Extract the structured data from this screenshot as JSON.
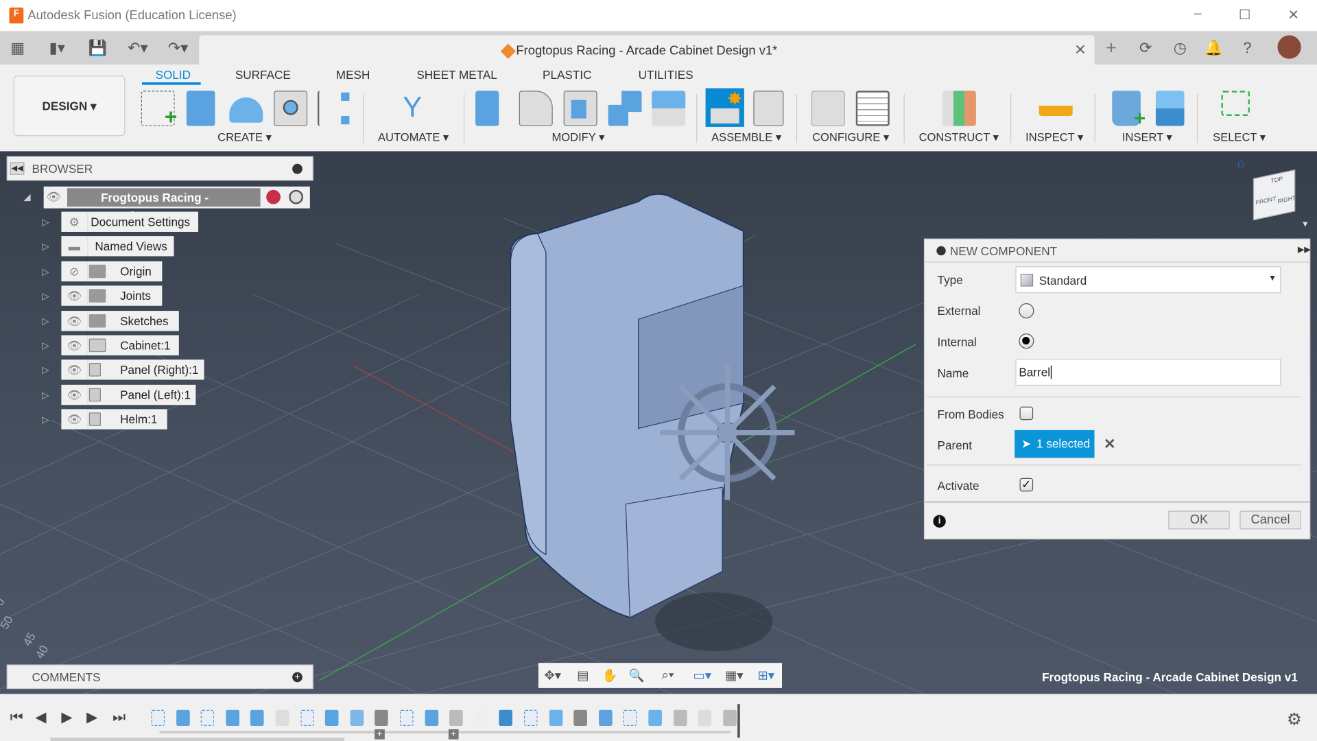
{
  "window": {
    "title": "Autodesk Fusion (Education License)",
    "logo_text": "F"
  },
  "quick_access": {
    "document_title": "Frogtopus Racing - Arcade Cabinet Design v1*"
  },
  "ribbon": {
    "workspace": "DESIGN ▾",
    "tabs": [
      "SOLID",
      "SURFACE",
      "MESH",
      "SHEET METAL",
      "PLASTIC",
      "UTILITIES"
    ],
    "active_tab": "SOLID",
    "groups": [
      "CREATE ▾",
      "AUTOMATE ▾",
      "MODIFY ▾",
      "ASSEMBLE ▾",
      "CONFIGURE ▾",
      "CONSTRUCT ▾",
      "INSPECT ▾",
      "INSERT ▾",
      "SELECT ▾"
    ],
    "accent": "#0b8ad4"
  },
  "browser": {
    "title": "BROWSER",
    "root": "Frogtopus Racing - Arcade...",
    "items": [
      {
        "label": "Document Settings",
        "icon": "gear-icon"
      },
      {
        "label": "Named Views",
        "icon": "folder-icon"
      },
      {
        "label": "Origin",
        "icon": "folder-icon",
        "hidden": true
      },
      {
        "label": "Joints",
        "icon": "folder-icon"
      },
      {
        "label": "Sketches",
        "icon": "folder-icon"
      },
      {
        "label": "Cabinet:1",
        "icon": "component-icon"
      },
      {
        "label": "Panel (Right):1",
        "icon": "body-icon"
      },
      {
        "label": "Panel (Left):1",
        "icon": "body-icon"
      },
      {
        "label": "Helm:1",
        "icon": "body-icon"
      }
    ]
  },
  "comments": {
    "title": "COMMENTS"
  },
  "viewcube": {
    "top": "TOP",
    "front": "FRONT",
    "right": "RIGHT"
  },
  "grid_labels": [
    "0",
    "50",
    "45",
    "40"
  ],
  "dialog": {
    "title": "NEW COMPONENT",
    "type_label": "Type",
    "type_value": "Standard",
    "external_label": "External",
    "internal_label": "Internal",
    "selected_option": "Internal",
    "name_label": "Name",
    "name_value": "Barrel",
    "from_bodies_label": "From Bodies",
    "from_bodies": false,
    "parent_label": "Parent",
    "parent_value": "1 selected",
    "activate_label": "Activate",
    "activate": true,
    "ok": "OK",
    "cancel": "Cancel"
  },
  "viewport_caption": "Frogtopus Racing - Arcade Cabinet Design v1"
}
